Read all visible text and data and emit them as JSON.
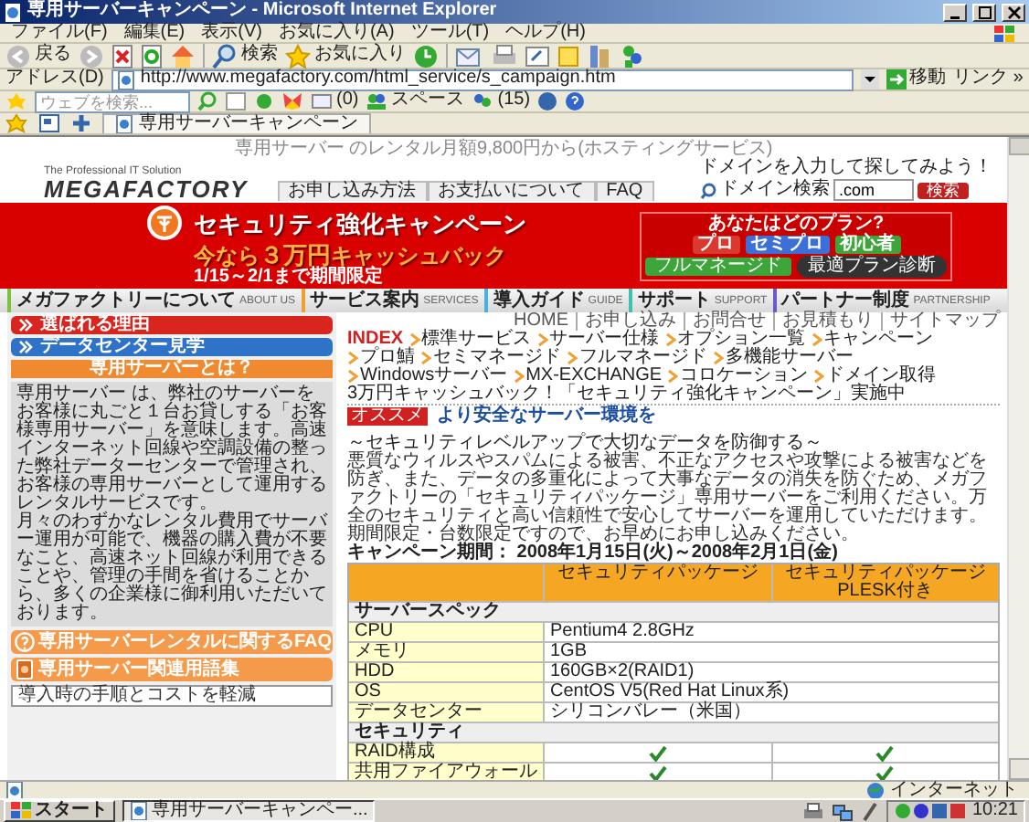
{
  "window": {
    "title": "専用サーバーキャンペーン - Microsoft Internet Explorer"
  },
  "menu": [
    "ファイル(F)",
    "編集(E)",
    "表示(V)",
    "お気に入り(A)",
    "ツール(T)",
    "ヘルプ(H)"
  ],
  "toolbar": {
    "back": "戻る",
    "search": "検索",
    "favorites": "お気に入り"
  },
  "address_bar": {
    "label": "アドレス(D)",
    "url": "http://www.megafactory.com/html_service/s_campaign.htm",
    "go": "移動",
    "links": "リンク »"
  },
  "search_bar": {
    "placeholder": "ウェブを検索...",
    "items": [
      "(0)",
      "スペース",
      "(15)"
    ]
  },
  "tabs": [
    {
      "label": "専用サーバーキャンペーン",
      "selected": true
    }
  ],
  "page": {
    "tagline": "専用サーバー のレンタル月額9,800円から(ホスティングサービス)",
    "logo": {
      "subtitle": "The Professional IT Solution",
      "name": "MEGAFACTORY"
    },
    "header_tabs": [
      "お申し込み方法",
      "お支払いについて",
      "FAQ"
    ],
    "domain_search": {
      "prompt": "ドメインを入力して探してみよう！",
      "label": "ドメイン検索",
      "value": ".com",
      "button": "検索"
    },
    "banner": {
      "title": "セキュリティ強化キャンペーン",
      "offer_lead": "今なら",
      "offer_amount": "３万円",
      "offer_rest": "キャッシュバック",
      "period": "1/15～2/1まで期間限定",
      "plan_panel": {
        "question": "あなたはどのプラン?",
        "plans": [
          {
            "label": "プロ",
            "color": "#d9392f"
          },
          {
            "label": "セミプロ",
            "color": "#3c6fd8"
          },
          {
            "label": "初心者",
            "color": "#3ea53a"
          }
        ],
        "full_managed": "フルマネージド",
        "diagnose": "最適プラン診断"
      }
    },
    "nav": [
      {
        "label": "メガファクトリーについて",
        "english": "ABOUT US",
        "color": "#7cc242"
      },
      {
        "label": "サービス案内",
        "english": "SERVICES",
        "color": "#f0a030"
      },
      {
        "label": "導入ガイド",
        "english": "GUIDE",
        "color": "#4ab0e0"
      },
      {
        "label": "サポート",
        "english": "SUPPORT",
        "color": "#40c0b0"
      },
      {
        "label": "パートナー制度",
        "english": "PARTNERSHIP",
        "color": "#6a5acd"
      }
    ],
    "utility_links": [
      "HOME",
      "お申し込み",
      "お問合せ",
      "お見積もり",
      "サイトマップ"
    ],
    "breadcrumb_label": "INDEX",
    "breadcrumb": [
      "標準サービス",
      "サーバー仕様",
      "オプション一覧",
      "キャンペーン",
      "プロ鯖",
      "セミマネージド",
      "フルマネージド",
      "多機能サーバー",
      "Windowsサーバー",
      "MX-EXCHANGE",
      "コロケーション",
      "ドメイン取得"
    ],
    "sidebar": {
      "buttons": [
        {
          "label": "選ばれる理由",
          "color": "#d8261f"
        },
        {
          "label": "データセンター見学",
          "color": "#2f73c9"
        }
      ],
      "about_title": "専用サーバーとは？",
      "about_paragraphs": [
        "専用サーバー は、弊社のサーバーをお客様に丸ごと１台お貸しする「お客様専用サーバー」を意味します。高速インターネット回線や空調設備の整った弊社データーセンターで管理され、お客様の専用サーバーとして運用するレンタルサービスです。",
        "月々のわずかなレンタル費用でサーバー運用が可能で、機器の購入費が不要なこと、高速ネット回線が利用できることや、管理の手間を省けることから、多くの企業様に御利用いただいております。"
      ],
      "faq": "専用サーバーレンタルに関するFAQ",
      "glossary": "専用サーバー関連用語集",
      "cost_link": "導入時の手順とコストを軽減"
    },
    "main": {
      "heading": "3万円キャッシュバック！「セキュリティ強化キャンペーン」実施中",
      "badge": "オススメ",
      "subheading": "より安全なサーバー環境を",
      "tagline": "～セキュリティレベルアップで大切なデータを防御する～",
      "paragraph": "悪質なウィルスやスパムによる被害、不正なアクセスや攻撃による被害などを防ぎ、また、データの多重化によって大事なデータの消失を防ぐため、メガファクトリーの「セキュリティパッケージ」専用サーバーをご利用ください。万全のセキュリティと高い信頼性で安心してサーバーを運用していただけます。期間限定・台数限定ですので、お早めにお申し込みください。",
      "period": "キャンペーン期間： 2008年1月15日(火)～2008年2月1日(金)",
      "table": {
        "columns": [
          "セキュリティパッケージ",
          "セキュリティパッケージ PLESK付き"
        ],
        "sections": [
          {
            "title": "サーバースペック",
            "rows": [
              {
                "kind": "text",
                "label": "CPU",
                "value": "Pentium4 2.8GHz"
              },
              {
                "kind": "text",
                "label": "メモリ",
                "value": "1GB"
              },
              {
                "kind": "text",
                "label": "HDD",
                "value": "160GB×2(RAID1)"
              },
              {
                "kind": "text",
                "label": "OS",
                "value": "CentOS V5(Red Hat Linux系)"
              },
              {
                "kind": "text",
                "label": "データセンター",
                "value": "シリコンバレー（米国）"
              }
            ]
          },
          {
            "title": "セキュリティ",
            "rows": [
              {
                "kind": "check",
                "label": "RAID構成",
                "checks": [
                  true,
                  true
                ]
              },
              {
                "kind": "check",
                "label": "共用ファイアウォール",
                "checks": [
                  true,
                  true
                ]
              }
            ]
          }
        ]
      }
    }
  },
  "status_bar": {
    "zone": "インターネット"
  },
  "taskbar": {
    "start": "スタート",
    "tasks": [
      {
        "label": "専用サーバーキャンペー...",
        "selected": true
      }
    ],
    "clock": "10:21"
  }
}
